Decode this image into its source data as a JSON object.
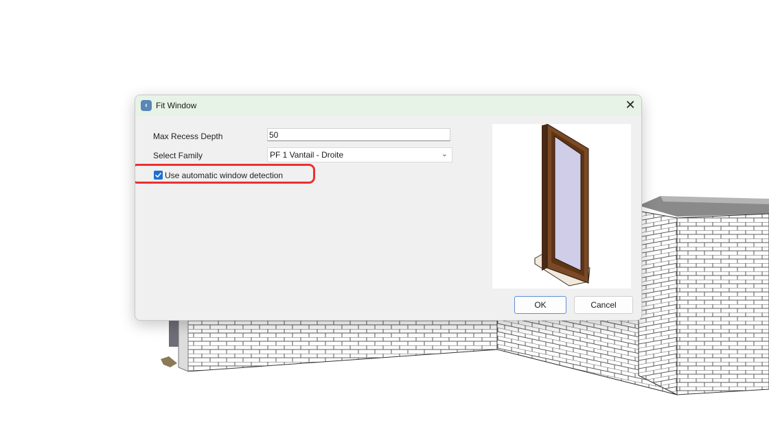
{
  "dialog": {
    "title": "Fit Window",
    "app_icon": "back-arrow-icon",
    "close_icon": "close-icon",
    "fields": {
      "recess_label": "Max Recess Depth",
      "recess_value": "50",
      "family_label": "Select Family",
      "family_value": "PF 1 Vantail - Droite"
    },
    "auto_detection": {
      "label": "Use automatic window detection",
      "checked": true
    },
    "preview_icon": "window-preview",
    "buttons": {
      "ok": "OK",
      "cancel": "Cancel"
    }
  },
  "colors": {
    "titlebar_bg": "#e6f3e6",
    "dialog_bg": "#f0f0f0",
    "highlight_border": "#ec2f2f",
    "checkbox_accent": "#1f6fd1",
    "ok_border": "#5b8fd8"
  }
}
